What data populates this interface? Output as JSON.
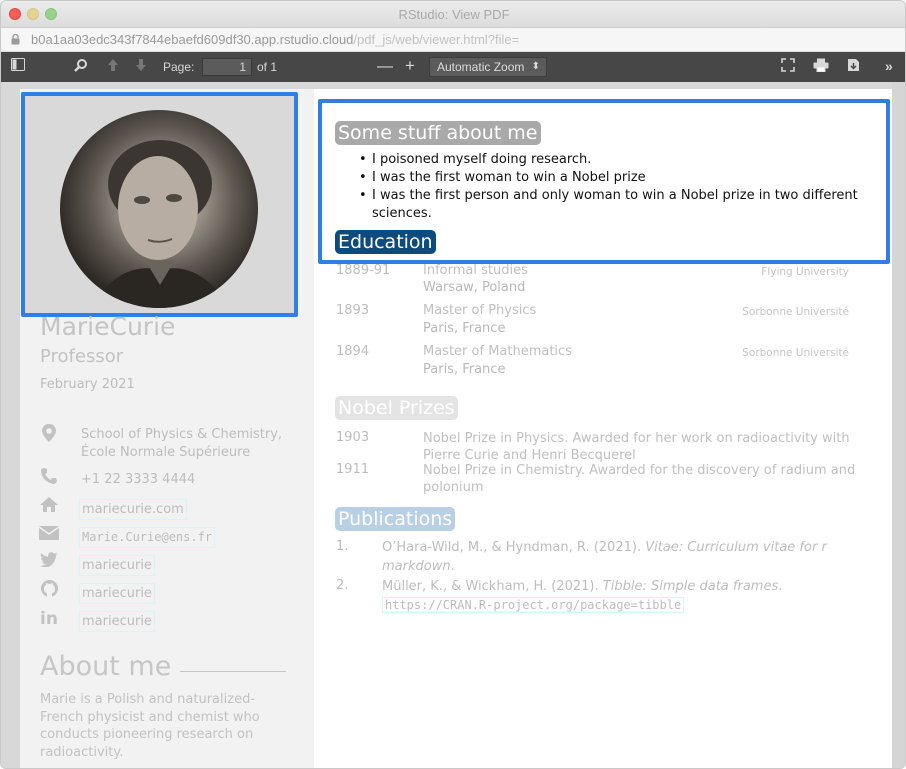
{
  "window": {
    "title": "RStudio: View PDF",
    "url_host": "b0a1aa03edc343f7844ebaefd609df30.app.rstudio.cloud",
    "url_rest": "/pdf_js/web/viewer.html?file="
  },
  "toolbar": {
    "page_label": "Page:",
    "page_value": "1",
    "page_total": "of 1",
    "zoom_value": "Automatic Zoom"
  },
  "cv": {
    "name": "MarieCurie",
    "role": "Professor",
    "date": "February 2021",
    "address_line1": "School of Physics & Chemistry,",
    "address_line2": "École Normale Supérieure",
    "phone": "+1 22 3333 4444",
    "website": "mariecurie.com",
    "email": "Marie.Curie@ens.fr",
    "twitter": "mariecurie",
    "github": "mariecurie",
    "linkedin": "mariecurie",
    "about_title": "About me",
    "about_text": "Marie is a Polish and naturalized-French physicist and chemist who conducts pioneering research on radioactivity.",
    "stuff_title": "Some stuff about me",
    "stuff_items": [
      "I poisoned myself doing research.",
      "I was the first woman to win a Nobel prize",
      "I was the first person and only woman to win a Nobel prize in two different sciences."
    ],
    "education_title": "Education",
    "education": [
      {
        "year": "1889-91",
        "title": "Informal studies",
        "place": "Warsaw, Poland",
        "inst": "Flying University"
      },
      {
        "year": "1893",
        "title": "Master of Physics",
        "place": "Paris, France",
        "inst": "Sorbonne Université"
      },
      {
        "year": "1894",
        "title": "Master of Mathematics",
        "place": "Paris, France",
        "inst": "Sorbonne Université"
      }
    ],
    "nobel_title": "Nobel Prizes",
    "nobel": [
      {
        "year": "1903",
        "text": "Nobel Prize in Physics. Awarded for her work on radioactivity with Pierre Curie and Henri Becquerel"
      },
      {
        "year": "1911",
        "text": "Nobel Prize in Chemistry. Awarded for the discovery of radium and polonium"
      }
    ],
    "pub_title": "Publications",
    "pubs": [
      {
        "num": "1.",
        "authors": "O’Hara-Wild, M., & Hyndman, R. (2021). ",
        "title": "Vitae: Curriculum vitae for r markdown",
        "tail": "."
      },
      {
        "num": "2.",
        "authors": "Müller, K., & Wickham, H. (2021). ",
        "title": "Tibble: Simple data frames",
        "tail": ". ",
        "link": "https://CRAN.R-project.org/package=tibble"
      }
    ]
  },
  "colors": {
    "highlight": "#2f7fe6",
    "section_education": "#0d4a7e",
    "section_stuff": "#a9a9a9"
  }
}
